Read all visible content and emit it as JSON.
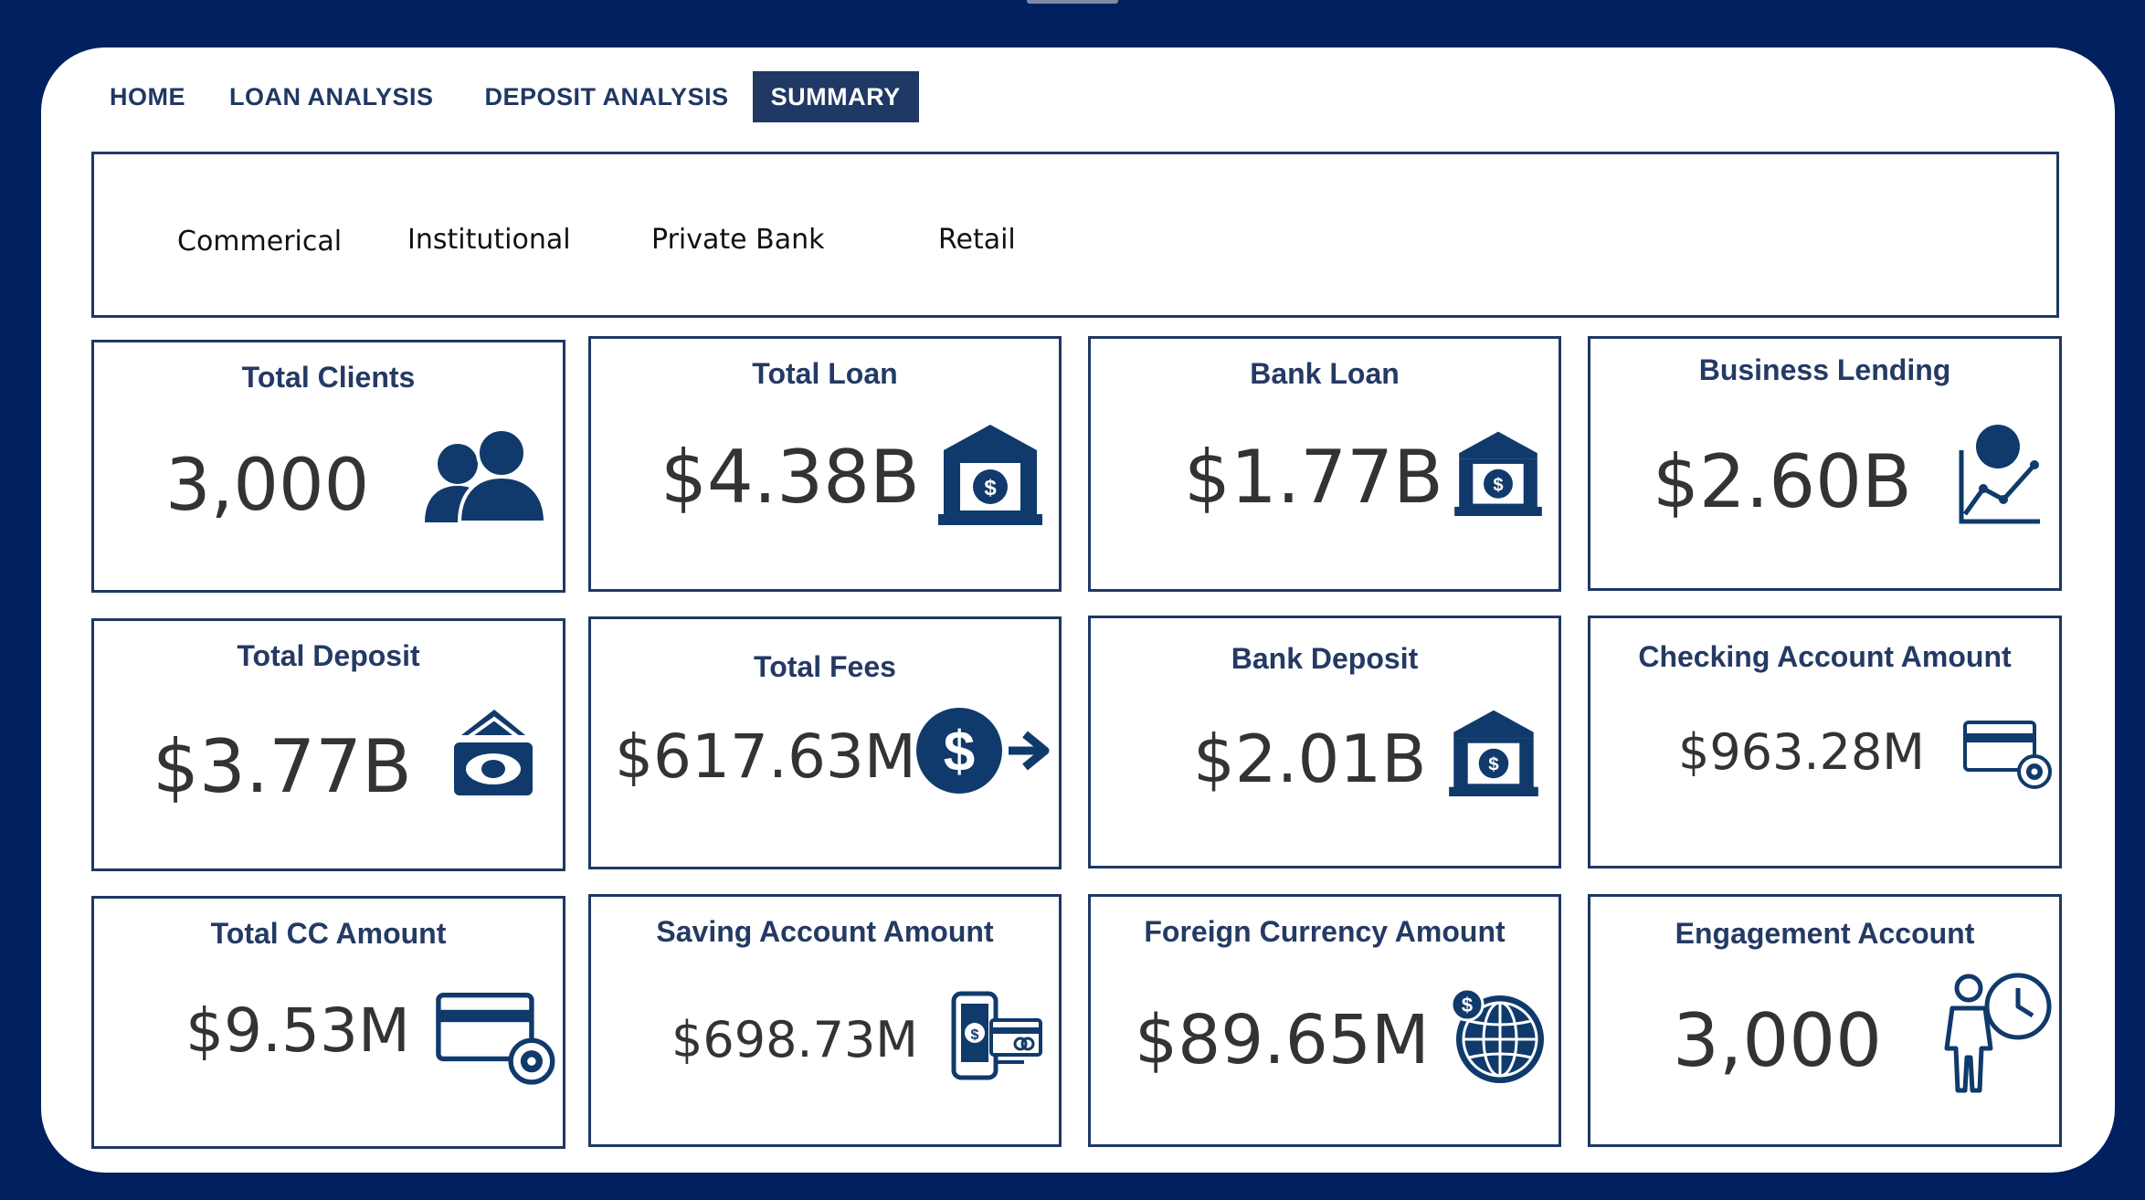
{
  "nav": {
    "tabs": [
      {
        "label": "HOME"
      },
      {
        "label": "LOAN ANALYSIS"
      },
      {
        "label": "DEPOSIT ANALYSIS"
      },
      {
        "label": "SUMMARY",
        "active": true
      }
    ]
  },
  "filters": [
    "Commerical",
    "Institutional",
    "Private Bank",
    "Retail"
  ],
  "kpis": [
    {
      "title": "Total Clients",
      "value": "3,000",
      "icon": "users-icon"
    },
    {
      "title": "Total Loan",
      "value": "$4.38B",
      "icon": "bank-icon"
    },
    {
      "title": "Bank Loan",
      "value": "$1.77B",
      "icon": "bank-icon"
    },
    {
      "title": "Business Lending",
      "value": "$2.60B",
      "icon": "growth-chart-icon"
    },
    {
      "title": "Total Deposit",
      "value": "$3.77B",
      "icon": "cash-icon"
    },
    {
      "title": "Total Fees",
      "value": "$617.63M",
      "icon": "dollar-arrow-icon"
    },
    {
      "title": "Bank Deposit",
      "value": "$2.01B",
      "icon": "bank-icon"
    },
    {
      "title": "Checking Account Amount",
      "value": "$963.28M",
      "icon": "card-gear-icon"
    },
    {
      "title": "Total CC Amount",
      "value": "$9.53M",
      "icon": "card-gear-icon"
    },
    {
      "title": "Saving Account Amount",
      "value": "$698.73M",
      "icon": "mobile-payment-icon"
    },
    {
      "title": "Foreign Currency Amount",
      "value": "$89.65M",
      "icon": "globe-dollar-icon"
    },
    {
      "title": "Engagement Account",
      "value": "3,000",
      "icon": "person-clock-icon"
    }
  ],
  "colors": {
    "background": "#002060",
    "accent": "#1f3864",
    "icon": "#103a6b"
  }
}
